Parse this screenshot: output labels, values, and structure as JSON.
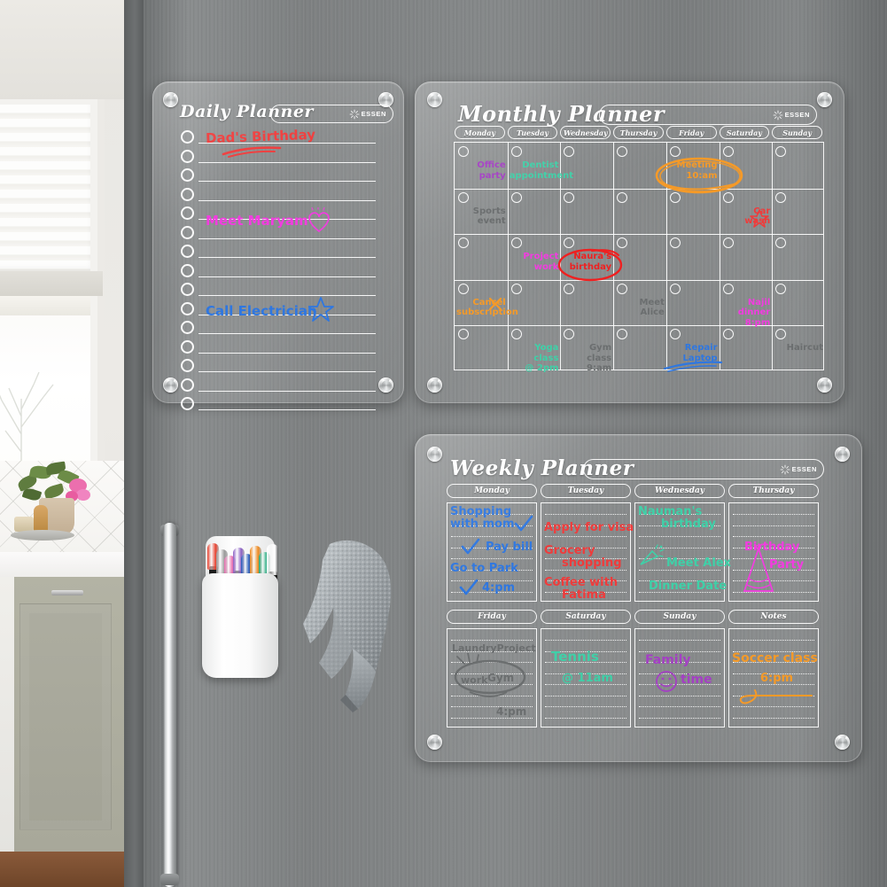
{
  "scene": {
    "description": "Acrylic dry-erase planner set mounted on a stainless steel refrigerator door",
    "fridge_color": "#7e8182",
    "board_tint": "rgba(255,255,255,0.10)"
  },
  "brand": {
    "name": "ESSEN",
    "mark": "sunburst-icon"
  },
  "daily": {
    "title": "Daily Planner",
    "title_field_placeholder": "",
    "rows": 15,
    "entries": [
      {
        "row": 0,
        "text": "Dad's Birthday",
        "color": "#ef3b3b",
        "underline": true,
        "icon": null
      },
      {
        "row": 5,
        "text": "Meet Maryam",
        "color": "#f23ce0",
        "underline": false,
        "icon": "heart-icon"
      },
      {
        "row": 9,
        "text": "Call Electrician",
        "color": "#2f77e0",
        "underline": false,
        "icon": "star-icon"
      }
    ]
  },
  "monthly": {
    "title": "Monthly Planner",
    "title_field_placeholder": "",
    "day_headers": [
      "Monday",
      "Tuesday",
      "Wednesday",
      "Thursday",
      "Friday",
      "Saturday",
      "Sunday"
    ],
    "rows": 5,
    "cols": 7,
    "entries": [
      {
        "row": 0,
        "col": 0,
        "text": "Office\nparty",
        "color": "#a43fc4",
        "highlight": null
      },
      {
        "row": 0,
        "col": 1,
        "text": "Dentist\nappointment",
        "color": "#3fd0a8",
        "highlight": null
      },
      {
        "row": 0,
        "col": 4,
        "text": "Meeting\n10:am",
        "color": "#f59a28",
        "highlight": "circle-orange"
      },
      {
        "row": 1,
        "col": 0,
        "text": "Sports\nevent",
        "color": "#6b6e6f",
        "highlight": null
      },
      {
        "row": 1,
        "col": 5,
        "text": "Car\nwash",
        "color": "#ef3b3b",
        "highlight": "star-icon"
      },
      {
        "row": 2,
        "col": 1,
        "text": "Project\nwork",
        "color": "#f23ce0",
        "highlight": null
      },
      {
        "row": 2,
        "col": 2,
        "text": "Naura's\nbirthday",
        "color": "#ef2020",
        "highlight": "circle-red"
      },
      {
        "row": 3,
        "col": 0,
        "text": "Cancel\nsubscription",
        "color": "#f59a28",
        "highlight": "x-icon"
      },
      {
        "row": 3,
        "col": 3,
        "text": "Meet\nAlice",
        "color": "#6b6e6f",
        "highlight": null
      },
      {
        "row": 3,
        "col": 5,
        "text": "Najil dinner\n8:pm",
        "color": "#f23ce0",
        "highlight": null
      },
      {
        "row": 4,
        "col": 1,
        "text": "Yoga class\n@ 2pm",
        "color": "#3fd0a8",
        "highlight": null
      },
      {
        "row": 4,
        "col": 2,
        "text": "Gym class\n9:am",
        "color": "#6b6e6f",
        "highlight": null
      },
      {
        "row": 4,
        "col": 4,
        "text": "Repair\nLaptop",
        "color": "#2f77e0",
        "highlight": "underline-blue"
      },
      {
        "row": 4,
        "col": 6,
        "text": "Haircut",
        "color": "#6b6e6f",
        "highlight": null
      }
    ]
  },
  "weekly": {
    "title": "Weekly Planner",
    "title_field_placeholder": "",
    "headers_row1": [
      "Monday",
      "Tuesday",
      "Wednesday",
      "Thursday"
    ],
    "headers_row2": [
      "Friday",
      "Saturday",
      "Sunday",
      "Notes"
    ],
    "lines_per_cell": 8,
    "entries": [
      {
        "cell": "Monday",
        "lines": [
          "Shopping",
          "with mom",
          "Pay bill",
          "Go to Park",
          "4:pm"
        ],
        "color": "#2f77e0",
        "icon": "check-icon"
      },
      {
        "cell": "Tuesday",
        "lines": [
          "Apply for visa",
          "Grocery",
          "shopping",
          "Coffee with",
          "Fatima"
        ],
        "color": "#ef3b3b",
        "icon": null
      },
      {
        "cell": "Wednesday",
        "lines": [
          "Nauman's",
          "birthday",
          "Meet Alex",
          "Dinner Date"
        ],
        "color": "#3fd0a8",
        "icon": "party-icon"
      },
      {
        "cell": "Thursday",
        "lines": [
          "Birthday",
          "Party"
        ],
        "color": "#f23ce0",
        "icon": "party-hat-icon"
      },
      {
        "cell": "Friday",
        "lines": [
          "LaundryProject",
          "work",
          "Gym",
          "4:pm"
        ],
        "color": "#6b6e6f",
        "icon": "circle-scribble"
      },
      {
        "cell": "Saturday",
        "lines": [
          "Tennis",
          "@ 11am"
        ],
        "color": "#3fd0a8",
        "icon": null
      },
      {
        "cell": "Sunday",
        "lines": [
          "Family",
          "time"
        ],
        "color": "#a43fc4",
        "icon": "smiley-icon"
      },
      {
        "cell": "Notes",
        "lines": [
          "Soccer class",
          "6:pm"
        ],
        "color": "#f59a28",
        "icon": "underline-swirl"
      }
    ]
  },
  "accessories": {
    "pen_holder": {
      "name": "magnetic pen holder",
      "body_color": "#ffffff",
      "pen_colors": [
        "#e8412f",
        "#9a9a9a",
        "#e86fb0",
        "#8b5fc4",
        "#2458b8",
        "#ef8a1f",
        "#1aa87a",
        "#ffffff"
      ]
    },
    "towel": {
      "name": "microfiber towel",
      "color": "#9ea4a8"
    }
  }
}
